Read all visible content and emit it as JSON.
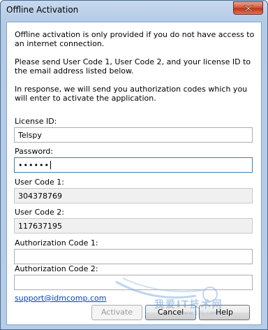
{
  "window": {
    "title": "Offline Activation"
  },
  "info": {
    "line1": "Offline activation is only provided if you do not have access to an internet connection.",
    "line2": "Please send User Code 1, User Code 2, and your license ID to the email address listed below.",
    "line3": "In response, we will send you authorization codes which you will enter to activate the application."
  },
  "form": {
    "license_id": {
      "label": "License ID:",
      "value": "Telspy"
    },
    "password": {
      "label": "Password:",
      "value": "••••••"
    },
    "user_code_1": {
      "label": "User Code 1:",
      "value": "304378769"
    },
    "user_code_2": {
      "label": "User Code 2:",
      "value": "117637195"
    },
    "auth_code_1": {
      "label": "Authorization Code 1:",
      "value": ""
    },
    "auth_code_2": {
      "label": "Authorization Code 2:",
      "value": ""
    }
  },
  "support_email": "support@idmcomp.com",
  "buttons": {
    "activate": "Activate",
    "cancel": "Cancel",
    "help": "Help"
  },
  "watermark": {
    "text": "我爱IT技术网",
    "url": "www.52ij.com"
  },
  "icons": {
    "close": "close-icon"
  }
}
